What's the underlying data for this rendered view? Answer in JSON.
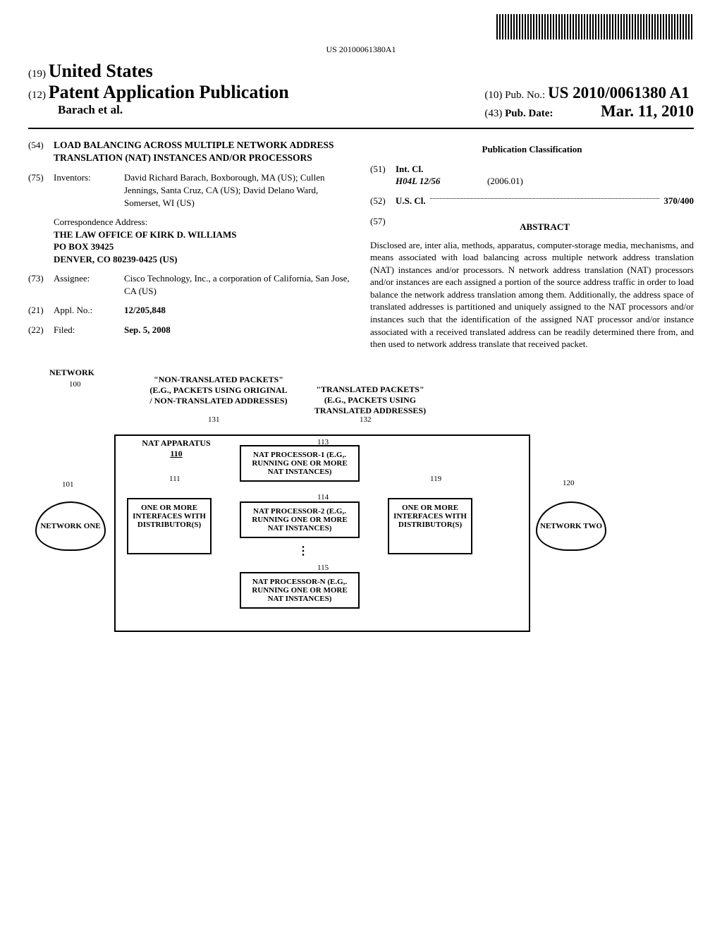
{
  "barcode_text": "US 20100061380A1",
  "header": {
    "country_code": "(19)",
    "country": "United States",
    "pub_code": "(12)",
    "pub_type": "Patent Application Publication",
    "authors": "Barach et al.",
    "pubno_code": "(10)",
    "pubno_label": "Pub. No.:",
    "pubno": "US 2010/0061380 A1",
    "pubdate_code": "(43)",
    "pubdate_label": "Pub. Date:",
    "pubdate": "Mar. 11, 2010"
  },
  "fields": {
    "title_code": "(54)",
    "title": "LOAD BALANCING ACROSS MULTIPLE NETWORK ADDRESS TRANSLATION (NAT) INSTANCES AND/OR PROCESSORS",
    "inventors_code": "(75)",
    "inventors_label": "Inventors:",
    "inventors": "David Richard Barach, Boxborough, MA (US); Cullen Jennings, Santa Cruz, CA (US); David Delano Ward, Somerset, WI (US)",
    "corr_label": "Correspondence Address:",
    "corr_line1": "THE LAW OFFICE OF KIRK D. WILLIAMS",
    "corr_line2": "PO BOX 39425",
    "corr_line3": "DENVER, CO 80239-0425 (US)",
    "assignee_code": "(73)",
    "assignee_label": "Assignee:",
    "assignee": "Cisco Technology, Inc., a corporation of California, San Jose, CA (US)",
    "applno_code": "(21)",
    "applno_label": "Appl. No.:",
    "applno": "12/205,848",
    "filed_code": "(22)",
    "filed_label": "Filed:",
    "filed": "Sep. 5, 2008"
  },
  "classification": {
    "heading": "Publication Classification",
    "intcl_code": "(51)",
    "intcl_label": "Int. Cl.",
    "intcl_class": "H04L 12/56",
    "intcl_year": "(2006.01)",
    "uscl_code": "(52)",
    "uscl_label": "U.S. Cl.",
    "uscl_value": "370/400"
  },
  "abstract": {
    "code": "(57)",
    "heading": "ABSTRACT",
    "text": "Disclosed are, inter alia, methods, apparatus, computer-storage media, mechanisms, and means associated with load balancing across multiple network address translation (NAT) instances and/or processors. N network address translation (NAT) processors and/or instances are each assigned a portion of the source address traffic in order to load balance the network address translation among them. Additionally, the address space of translated addresses is partitioned and uniquely assigned to the NAT processors and/or instances such that the identification of the assigned NAT processor and/or instance associated with a received translated address can be readily determined there from, and then used to network address translate that received packet."
  },
  "figure": {
    "network_label": "NETWORK",
    "ref100": "100",
    "ref101": "101",
    "ref110": "110",
    "ref111": "111",
    "ref113": "113",
    "ref114": "114",
    "ref115": "115",
    "ref119": "119",
    "ref120": "120",
    "ref131": "131",
    "ref132": "132",
    "nontrans_title": "\"NON-TRANSLATED PACKETS\" (E.G., PACKETS USING ORIGINAL / NON-TRANSLATED ADDRESSES)",
    "trans_title": "\"TRANSLATED PACKETS\" (E.G., PACKETS USING TRANSLATED ADDRESSES)",
    "nat_apparatus": "NAT APPARATUS",
    "interfaces": "ONE OR MORE INTERFACES WITH DISTRIBUTOR(S)",
    "natproc1": "NAT PROCESSOR-1 (E.G,. RUNNING ONE OR MORE NAT INSTANCES)",
    "natproc2": "NAT PROCESSOR-2 (E.G,. RUNNING ONE OR MORE NAT INSTANCES)",
    "natprocn": "NAT PROCESSOR-N (E.G,. RUNNING ONE OR MORE NAT INSTANCES)",
    "network_one": "NETWORK ONE",
    "network_two": "NETWORK TWO"
  }
}
